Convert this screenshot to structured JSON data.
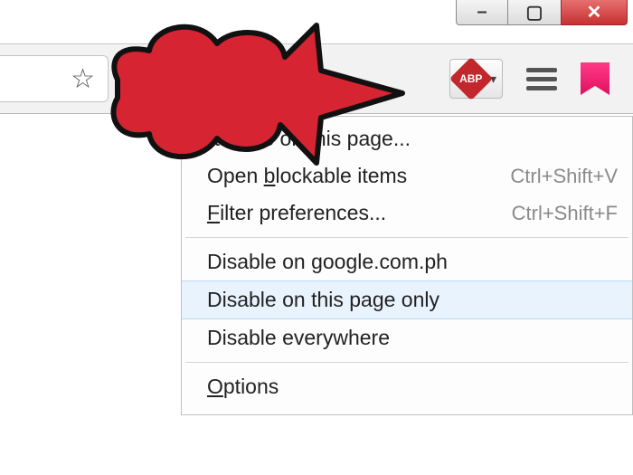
{
  "window_controls": {
    "minimize": "–",
    "maximize": "▢",
    "close": "✕"
  },
  "toolbar": {
    "abp_label": "ABP",
    "dropdown_caret": "▾"
  },
  "menu": {
    "items": [
      {
        "label_before": "",
        "accel": "",
        "label_after": "rt issue on this page...",
        "shortcut": ""
      },
      {
        "label_before": "Open ",
        "accel": "b",
        "label_after": "lockable items",
        "shortcut": "Ctrl+Shift+V"
      },
      {
        "label_before": "",
        "accel": "F",
        "label_after": "ilter preferences...",
        "shortcut": "Ctrl+Shift+F"
      }
    ],
    "disable": [
      {
        "label": "Disable on google.com.ph"
      },
      {
        "label": "Disable on this page only",
        "highlight": true
      },
      {
        "label": "Disable everywhere"
      }
    ],
    "options_before": "",
    "options_accel": "O",
    "options_after": "ptions"
  }
}
